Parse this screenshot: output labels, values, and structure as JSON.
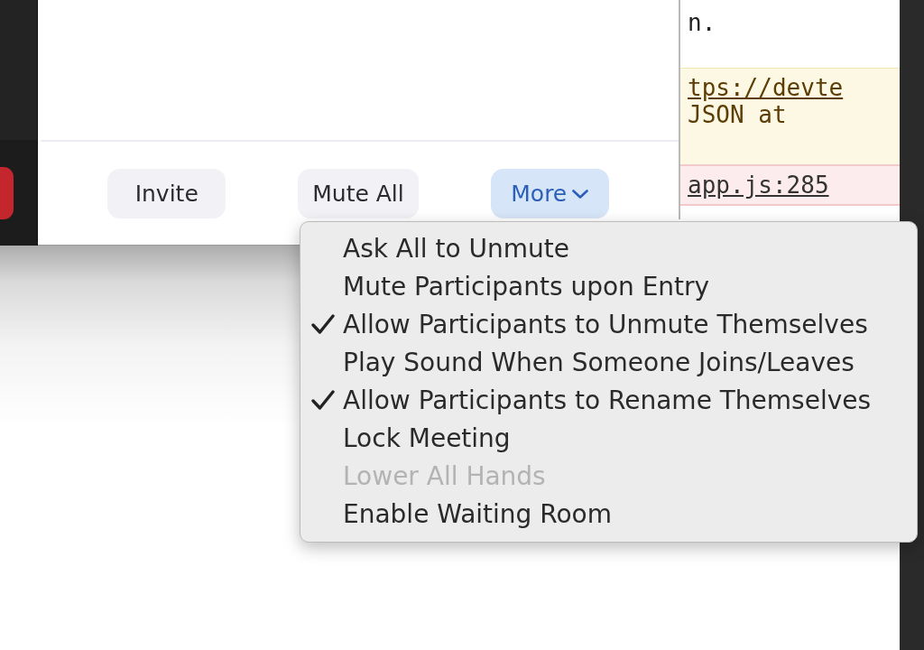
{
  "participants_panel": {
    "buttons": [
      {
        "label": "Invite",
        "kind": "plain",
        "selected": false
      },
      {
        "label": "Mute All",
        "kind": "plain",
        "selected": false
      },
      {
        "label": "More",
        "kind": "dropdown",
        "selected": true
      }
    ]
  },
  "console": {
    "entries": [
      {
        "kind": "log",
        "lines": [
          {
            "kind": "text",
            "text": "n."
          }
        ]
      },
      {
        "kind": "warning",
        "lines": [
          {
            "kind": "link",
            "text": "tps://devte"
          },
          {
            "kind": "text",
            "text": "JSON at"
          }
        ]
      },
      {
        "kind": "error",
        "lines": [
          {
            "kind": "link",
            "text": "app.js:285"
          }
        ]
      }
    ]
  },
  "more_menu": {
    "items": [
      {
        "label": "Ask All to Unmute",
        "checked": false,
        "disabled": false
      },
      {
        "label": "Mute Participants upon Entry",
        "checked": false,
        "disabled": false
      },
      {
        "label": "Allow Participants to Unmute Themselves",
        "checked": true,
        "disabled": false
      },
      {
        "label": "Play Sound When Someone Joins/Leaves",
        "checked": false,
        "disabled": false
      },
      {
        "label": "Allow Participants to Rename Themselves",
        "checked": true,
        "disabled": false
      },
      {
        "label": "Lock Meeting",
        "checked": false,
        "disabled": false
      },
      {
        "label": "Lower All Hands",
        "checked": false,
        "disabled": true
      },
      {
        "label": "Enable Waiting Room",
        "checked": false,
        "disabled": false
      }
    ]
  }
}
